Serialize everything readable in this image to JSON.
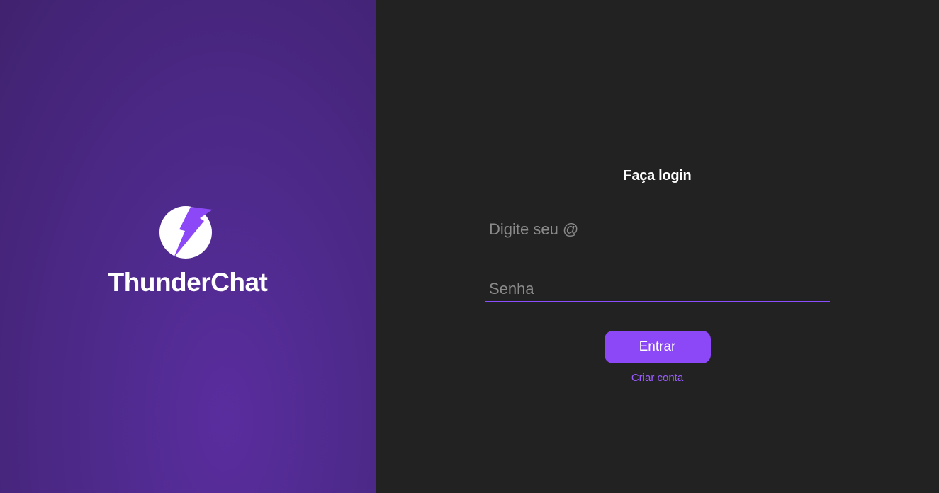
{
  "brand": {
    "name": "ThunderChat",
    "logo_icon": "lightning-bolt-icon"
  },
  "login": {
    "title": "Faça login",
    "email_placeholder": "Digite seu @",
    "password_placeholder": "Senha",
    "submit_label": "Entrar",
    "signup_link": "Criar conta"
  },
  "colors": {
    "accent": "#8c47f7",
    "panel_left": "#4e2a8c",
    "panel_right": "#222222"
  }
}
